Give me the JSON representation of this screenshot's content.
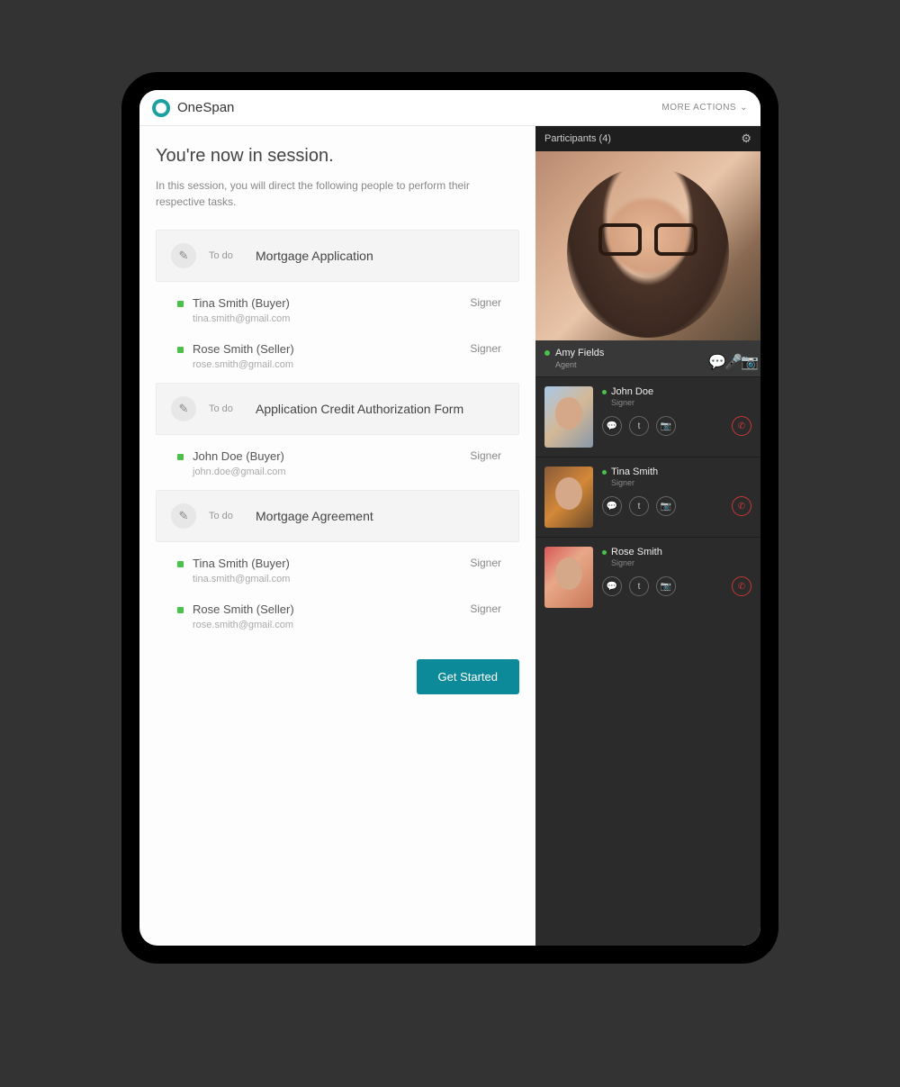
{
  "brand": "OneSpan",
  "more_actions": "MORE ACTIONS",
  "session": {
    "title": "You're now in session.",
    "description": "In this session, you will direct the following people to perform their respective tasks."
  },
  "tasks": [
    {
      "status": "To do",
      "name": "Mortgage Application",
      "signers": [
        {
          "name": "Tina Smith (Buyer)",
          "email": "tina.smith@gmail.com",
          "role": "Signer"
        },
        {
          "name": "Rose Smith (Seller)",
          "email": "rose.smith@gmail.com",
          "role": "Signer"
        }
      ]
    },
    {
      "status": "To do",
      "name": "Application Credit Authorization Form",
      "signers": [
        {
          "name": "John Doe (Buyer)",
          "email": "john.doe@gmail.com",
          "role": "Signer"
        }
      ]
    },
    {
      "status": "To do",
      "name": "Mortgage Agreement",
      "signers": [
        {
          "name": "Tina Smith (Buyer)",
          "email": "tina.smith@gmail.com",
          "role": "Signer"
        },
        {
          "name": "Rose Smith (Seller)",
          "email": "rose.smith@gmail.com",
          "role": "Signer"
        }
      ]
    }
  ],
  "get_started": "Get Started",
  "participants": {
    "header": "Participants (4)",
    "main": {
      "name": "Amy Fields",
      "role": "Agent"
    },
    "list": [
      {
        "name": "John Doe",
        "role": "Signer"
      },
      {
        "name": "Tina Smith",
        "role": "Signer"
      },
      {
        "name": "Rose Smith",
        "role": "Signer"
      }
    ]
  }
}
